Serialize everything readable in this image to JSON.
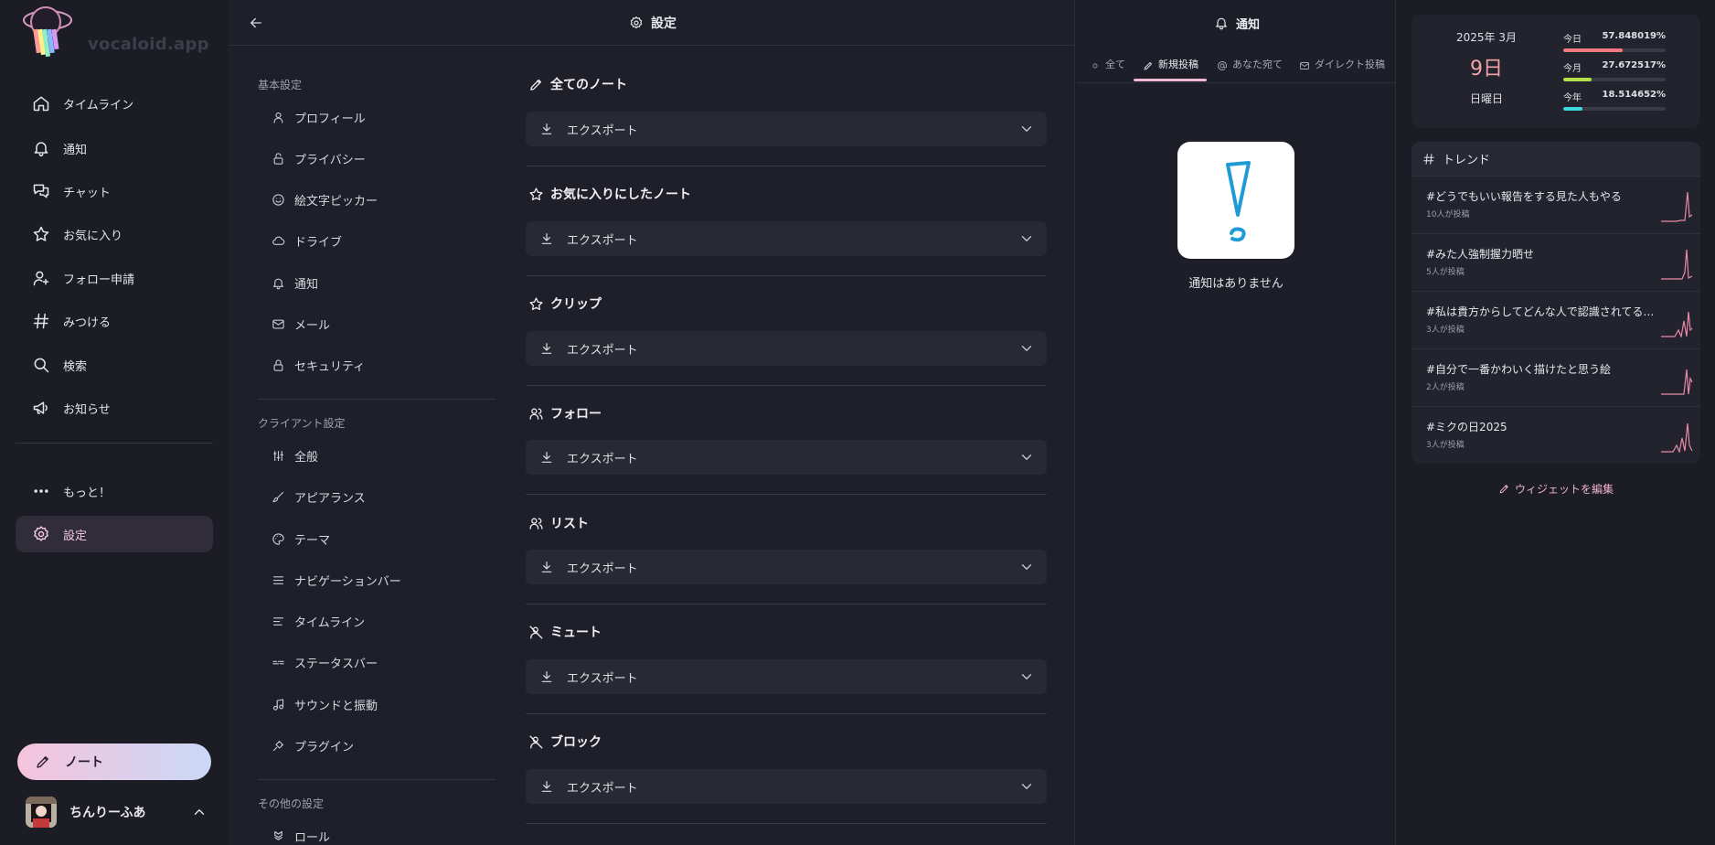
{
  "app": {
    "name": "vocaloid.app"
  },
  "nav": {
    "items": [
      {
        "label": "タイムライン",
        "icon": "home-icon"
      },
      {
        "label": "通知",
        "icon": "bell-icon"
      },
      {
        "label": "チャット",
        "icon": "chat-icon"
      },
      {
        "label": "お気に入り",
        "icon": "star-icon"
      },
      {
        "label": "フォロー申請",
        "icon": "user-plus-icon"
      },
      {
        "label": "みつける",
        "icon": "hash-icon"
      },
      {
        "label": "検索",
        "icon": "search-icon"
      },
      {
        "label": "お知らせ",
        "icon": "megaphone-icon"
      }
    ],
    "more": "もっと！",
    "settings": "設定",
    "note_button": "ノート",
    "account": "ちんりーふあ"
  },
  "settings": {
    "title": "設定",
    "categories": {
      "basic": "基本設定",
      "client": "クライアント設定",
      "other": "その他の設定"
    },
    "basic_items": [
      "プロフィール",
      "プライバシー",
      "絵文字ピッカー",
      "ドライブ",
      "通知",
      "メール",
      "セキュリティ"
    ],
    "client_items": [
      "全般",
      "アピアランス",
      "テーマ",
      "ナビゲーションバー",
      "タイムライン",
      "ステータスバー",
      "サウンドと振動",
      "プラグイン"
    ],
    "other_items": [
      "ロール"
    ],
    "sections": [
      {
        "title": "全てのノート",
        "export": "エクスポート"
      },
      {
        "title": "お気に入りにしたノート",
        "export": "エクスポート"
      },
      {
        "title": "クリップ",
        "export": "エクスポート"
      },
      {
        "title": "フォロー",
        "export": "エクスポート"
      },
      {
        "title": "リスト",
        "export": "エクスポート"
      },
      {
        "title": "ミュート",
        "export": "エクスポート"
      },
      {
        "title": "ブロック",
        "export": "エクスポート"
      }
    ]
  },
  "notifications": {
    "title": "通知",
    "tabs": [
      "全て",
      "新規投稿",
      "あなた宛て",
      "ダイレクト投稿"
    ],
    "active_tab": "新規投稿",
    "empty": "通知はありません"
  },
  "calendar": {
    "year_month": "2025年 3月",
    "day": "9日",
    "weekday": "日曜日",
    "stats": [
      {
        "label": "今日",
        "value": "57.848019%",
        "percent": 57.848019,
        "color": "#f07a80"
      },
      {
        "label": "今月",
        "value": "27.672517%",
        "percent": 27.672517,
        "color": "#b4e048"
      },
      {
        "label": "今年",
        "value": "18.514652%",
        "percent": 18.514652,
        "color": "#40d8e0"
      }
    ]
  },
  "trends": {
    "title": "トレンド",
    "items": [
      {
        "tag": "#どうでもいい報告をする見た人もやる",
        "count": "10人が投稿"
      },
      {
        "tag": "#みた人強制握力晒せ",
        "count": "5人が投稿"
      },
      {
        "tag": "#私は貴方からしてどんな人で認識されてるの…",
        "count": "3人が投稿"
      },
      {
        "tag": "#自分で一番かわいく描けたと思う絵",
        "count": "2人が投稿"
      },
      {
        "tag": "#ミクの日2025",
        "count": "3人が投稿"
      }
    ]
  },
  "widgets": {
    "edit": "ウィジェットを編集"
  },
  "colors": {
    "accent": "#f2b9d3",
    "background": "#1b1c24",
    "panel": "#22232d"
  }
}
